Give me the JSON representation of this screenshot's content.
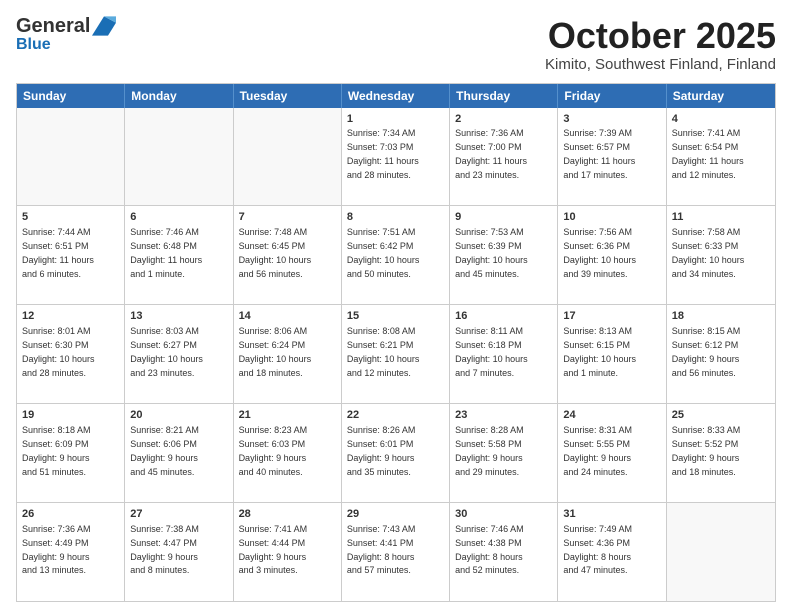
{
  "header": {
    "logo_general": "General",
    "logo_blue": "Blue",
    "title": "October 2025",
    "subtitle": "Kimito, Southwest Finland, Finland"
  },
  "days": [
    "Sunday",
    "Monday",
    "Tuesday",
    "Wednesday",
    "Thursday",
    "Friday",
    "Saturday"
  ],
  "weeks": [
    [
      {
        "num": "",
        "empty": true,
        "text": ""
      },
      {
        "num": "",
        "empty": true,
        "text": ""
      },
      {
        "num": "",
        "empty": true,
        "text": ""
      },
      {
        "num": "1",
        "text": "Sunrise: 7:34 AM\nSunset: 7:03 PM\nDaylight: 11 hours\nand 28 minutes."
      },
      {
        "num": "2",
        "text": "Sunrise: 7:36 AM\nSunset: 7:00 PM\nDaylight: 11 hours\nand 23 minutes."
      },
      {
        "num": "3",
        "text": "Sunrise: 7:39 AM\nSunset: 6:57 PM\nDaylight: 11 hours\nand 17 minutes."
      },
      {
        "num": "4",
        "text": "Sunrise: 7:41 AM\nSunset: 6:54 PM\nDaylight: 11 hours\nand 12 minutes."
      }
    ],
    [
      {
        "num": "5",
        "text": "Sunrise: 7:44 AM\nSunset: 6:51 PM\nDaylight: 11 hours\nand 6 minutes."
      },
      {
        "num": "6",
        "text": "Sunrise: 7:46 AM\nSunset: 6:48 PM\nDaylight: 11 hours\nand 1 minute."
      },
      {
        "num": "7",
        "text": "Sunrise: 7:48 AM\nSunset: 6:45 PM\nDaylight: 10 hours\nand 56 minutes."
      },
      {
        "num": "8",
        "text": "Sunrise: 7:51 AM\nSunset: 6:42 PM\nDaylight: 10 hours\nand 50 minutes."
      },
      {
        "num": "9",
        "text": "Sunrise: 7:53 AM\nSunset: 6:39 PM\nDaylight: 10 hours\nand 45 minutes."
      },
      {
        "num": "10",
        "text": "Sunrise: 7:56 AM\nSunset: 6:36 PM\nDaylight: 10 hours\nand 39 minutes."
      },
      {
        "num": "11",
        "text": "Sunrise: 7:58 AM\nSunset: 6:33 PM\nDaylight: 10 hours\nand 34 minutes."
      }
    ],
    [
      {
        "num": "12",
        "text": "Sunrise: 8:01 AM\nSunset: 6:30 PM\nDaylight: 10 hours\nand 28 minutes."
      },
      {
        "num": "13",
        "text": "Sunrise: 8:03 AM\nSunset: 6:27 PM\nDaylight: 10 hours\nand 23 minutes."
      },
      {
        "num": "14",
        "text": "Sunrise: 8:06 AM\nSunset: 6:24 PM\nDaylight: 10 hours\nand 18 minutes."
      },
      {
        "num": "15",
        "text": "Sunrise: 8:08 AM\nSunset: 6:21 PM\nDaylight: 10 hours\nand 12 minutes."
      },
      {
        "num": "16",
        "text": "Sunrise: 8:11 AM\nSunset: 6:18 PM\nDaylight: 10 hours\nand 7 minutes."
      },
      {
        "num": "17",
        "text": "Sunrise: 8:13 AM\nSunset: 6:15 PM\nDaylight: 10 hours\nand 1 minute."
      },
      {
        "num": "18",
        "text": "Sunrise: 8:15 AM\nSunset: 6:12 PM\nDaylight: 9 hours\nand 56 minutes."
      }
    ],
    [
      {
        "num": "19",
        "text": "Sunrise: 8:18 AM\nSunset: 6:09 PM\nDaylight: 9 hours\nand 51 minutes."
      },
      {
        "num": "20",
        "text": "Sunrise: 8:21 AM\nSunset: 6:06 PM\nDaylight: 9 hours\nand 45 minutes."
      },
      {
        "num": "21",
        "text": "Sunrise: 8:23 AM\nSunset: 6:03 PM\nDaylight: 9 hours\nand 40 minutes."
      },
      {
        "num": "22",
        "text": "Sunrise: 8:26 AM\nSunset: 6:01 PM\nDaylight: 9 hours\nand 35 minutes."
      },
      {
        "num": "23",
        "text": "Sunrise: 8:28 AM\nSunset: 5:58 PM\nDaylight: 9 hours\nand 29 minutes."
      },
      {
        "num": "24",
        "text": "Sunrise: 8:31 AM\nSunset: 5:55 PM\nDaylight: 9 hours\nand 24 minutes."
      },
      {
        "num": "25",
        "text": "Sunrise: 8:33 AM\nSunset: 5:52 PM\nDaylight: 9 hours\nand 18 minutes."
      }
    ],
    [
      {
        "num": "26",
        "text": "Sunrise: 7:36 AM\nSunset: 4:49 PM\nDaylight: 9 hours\nand 13 minutes."
      },
      {
        "num": "27",
        "text": "Sunrise: 7:38 AM\nSunset: 4:47 PM\nDaylight: 9 hours\nand 8 minutes."
      },
      {
        "num": "28",
        "text": "Sunrise: 7:41 AM\nSunset: 4:44 PM\nDaylight: 9 hours\nand 3 minutes."
      },
      {
        "num": "29",
        "text": "Sunrise: 7:43 AM\nSunset: 4:41 PM\nDaylight: 8 hours\nand 57 minutes."
      },
      {
        "num": "30",
        "text": "Sunrise: 7:46 AM\nSunset: 4:38 PM\nDaylight: 8 hours\nand 52 minutes."
      },
      {
        "num": "31",
        "text": "Sunrise: 7:49 AM\nSunset: 4:36 PM\nDaylight: 8 hours\nand 47 minutes."
      },
      {
        "num": "",
        "empty": true,
        "text": ""
      }
    ]
  ]
}
